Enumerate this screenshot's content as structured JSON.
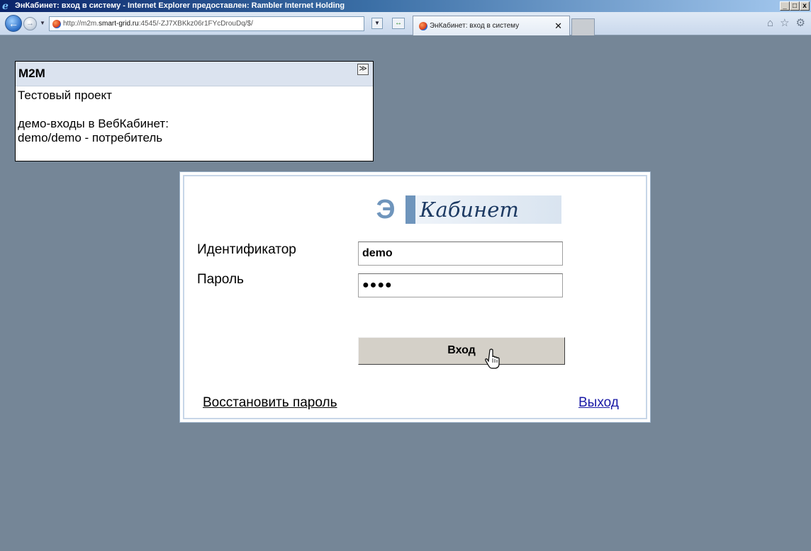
{
  "browser": {
    "window_title": "ЭнКабинет: вход в систему - Internet Explorer предоставлен: Rambler Internet Holding",
    "address_prefix": "http://m2m.",
    "address_domain": "smart-grid.ru",
    "address_suffix": ":4545/-ZJ7XBKkz06r1FYcDrouDq/$/",
    "tab_title": "ЭнКабинет: вход в систему",
    "tab_close": "✕",
    "controls": {
      "minimize": "_",
      "maximize": "□",
      "close": "x"
    },
    "tools": {
      "home": "⌂",
      "favorites": "☆",
      "settings": "⚙"
    },
    "nav": {
      "back": "←",
      "forward": "→",
      "dropdown": "▼",
      "address_dropdown": "▼",
      "refresh": "↔"
    }
  },
  "info_panel": {
    "title": "M2M",
    "collapse": "≫",
    "lines": [
      "Тестовый проект",
      "",
      "демо-входы в ВебКабинет:",
      "demo/demo - потребитель"
    ]
  },
  "login": {
    "logo_letter": "Э",
    "logo_word": "Кабинет",
    "id_label": "Идентификатор",
    "id_value": "demo",
    "password_label": "Пароль",
    "password_value": "●●●●",
    "submit_label": "Вход",
    "restore_link": "Восстановить пароль",
    "exit_link": "Выход"
  },
  "colors": {
    "page_background": "#758697",
    "info_header": "#dbe3ef",
    "logo_blue": "#6f95bc",
    "exit_link": "#1a1aa6"
  }
}
